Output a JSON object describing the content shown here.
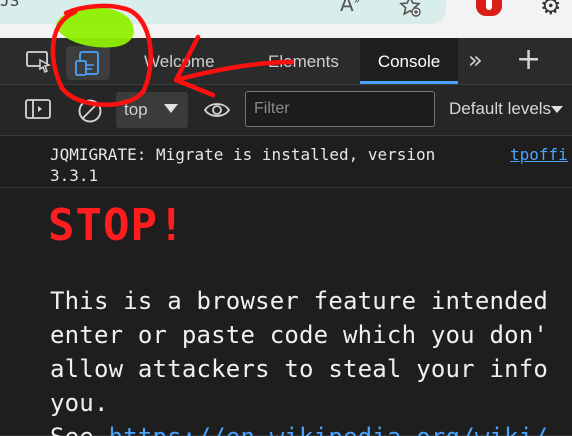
{
  "browser": {
    "strip_text": "JS",
    "read_aloud_icon": "read-aloud-icon",
    "favorites_icon": "favorites-icon",
    "extension_icon": "extension-icon",
    "settings_icon": "gear-icon"
  },
  "devtools": {
    "tabs": [
      {
        "label": "Welcome",
        "active": false
      },
      {
        "label": "Elements",
        "active": false
      },
      {
        "label": "Console",
        "active": true
      }
    ],
    "more_tabs_label": "»",
    "add_tab_label": "+"
  },
  "toolbar": {
    "context": "top",
    "filter_placeholder": "Filter",
    "levels": "Default levels"
  },
  "console": {
    "log": {
      "message": "JQMIGRATE: Migrate is installed, version 3.3.1",
      "source": "tpoffi"
    },
    "stop": "STOP!",
    "warning_lines": [
      "This is a browser feature intended",
      "enter or paste code which you don'",
      "allow attackers to steal your info",
      "you."
    ],
    "see_prefix": "See ",
    "see_url": "https://en.wikipedia.org/wiki/"
  },
  "annotation": {
    "color": "#ff1010",
    "highlight_color": "#8ff000"
  }
}
